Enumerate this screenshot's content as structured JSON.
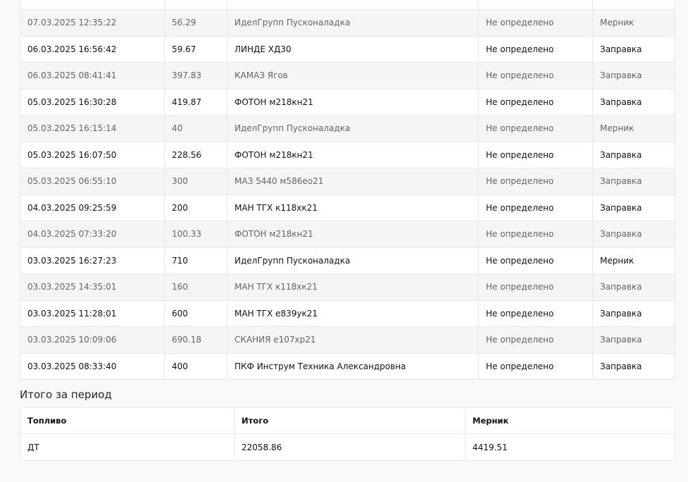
{
  "log": {
    "rows": [
      {
        "datetime": "07.03.2025 12:35:22",
        "volume": "56.29",
        "vehicle": "ИделГрупп Пусконаладка",
        "status": "Не определено",
        "type": "Мерник"
      },
      {
        "datetime": "06.03.2025 16:56:42",
        "volume": "59.67",
        "vehicle": "ЛИНДЕ ХД30",
        "status": "Не определено",
        "type": "Заправка"
      },
      {
        "datetime": "06.03.2025 08:41:41",
        "volume": "397.83",
        "vehicle": "КАМАЗ Ягов",
        "status": "Не определено",
        "type": "Заправка"
      },
      {
        "datetime": "05.03.2025 16:30:28",
        "volume": "419.87",
        "vehicle": "ФОТОН м218кн21",
        "status": "Не определено",
        "type": "Заправка"
      },
      {
        "datetime": "05.03.2025 16:15:14",
        "volume": "40",
        "vehicle": "ИделГрупп Пусконаладка",
        "status": "Не определено",
        "type": "Мерник"
      },
      {
        "datetime": "05.03.2025 16:07:50",
        "volume": "228.56",
        "vehicle": "ФОТОН м218кн21",
        "status": "Не определено",
        "type": "Заправка"
      },
      {
        "datetime": "05.03.2025 06:55:10",
        "volume": "300",
        "vehicle": "МАЗ 5440 м586ео21",
        "status": "Не определено",
        "type": "Заправка"
      },
      {
        "datetime": "04.03.2025 09:25:59",
        "volume": "200",
        "vehicle": "МАН ТГХ к118хк21",
        "status": "Не определено",
        "type": "Заправка"
      },
      {
        "datetime": "04.03.2025 07:33:20",
        "volume": "100.33",
        "vehicle": "ФОТОН м218кн21",
        "status": "Не определено",
        "type": "Заправка"
      },
      {
        "datetime": "03.03.2025 16:27:23",
        "volume": "710",
        "vehicle": "ИделГрупп Пусконаладка",
        "status": "Не определено",
        "type": "Мерник"
      },
      {
        "datetime": "03.03.2025 14:35:01",
        "volume": "160",
        "vehicle": "МАН ТГХ к118хк21",
        "status": "Не определено",
        "type": "Заправка"
      },
      {
        "datetime": "03.03.2025 11:28:01",
        "volume": "600",
        "vehicle": "МАН ТГХ е839ук21",
        "status": "Не определено",
        "type": "Заправка"
      },
      {
        "datetime": "03.03.2025 10:09:06",
        "volume": "690.18",
        "vehicle": "СКАНИЯ е107хр21",
        "status": "Не определено",
        "type": "Заправка"
      },
      {
        "datetime": "03.03.2025 08:33:40",
        "volume": "400",
        "vehicle": "ПКФ Инструм Техника Александровна",
        "status": "Не определено",
        "type": "Заправка"
      }
    ]
  },
  "totals": {
    "title": "Итого за период",
    "headers": {
      "fuel": "Топливо",
      "total": "Итого",
      "gauge": "Мерник"
    },
    "row": {
      "fuel": "ДТ",
      "total": "22058.86",
      "gauge": "4419.51"
    }
  }
}
